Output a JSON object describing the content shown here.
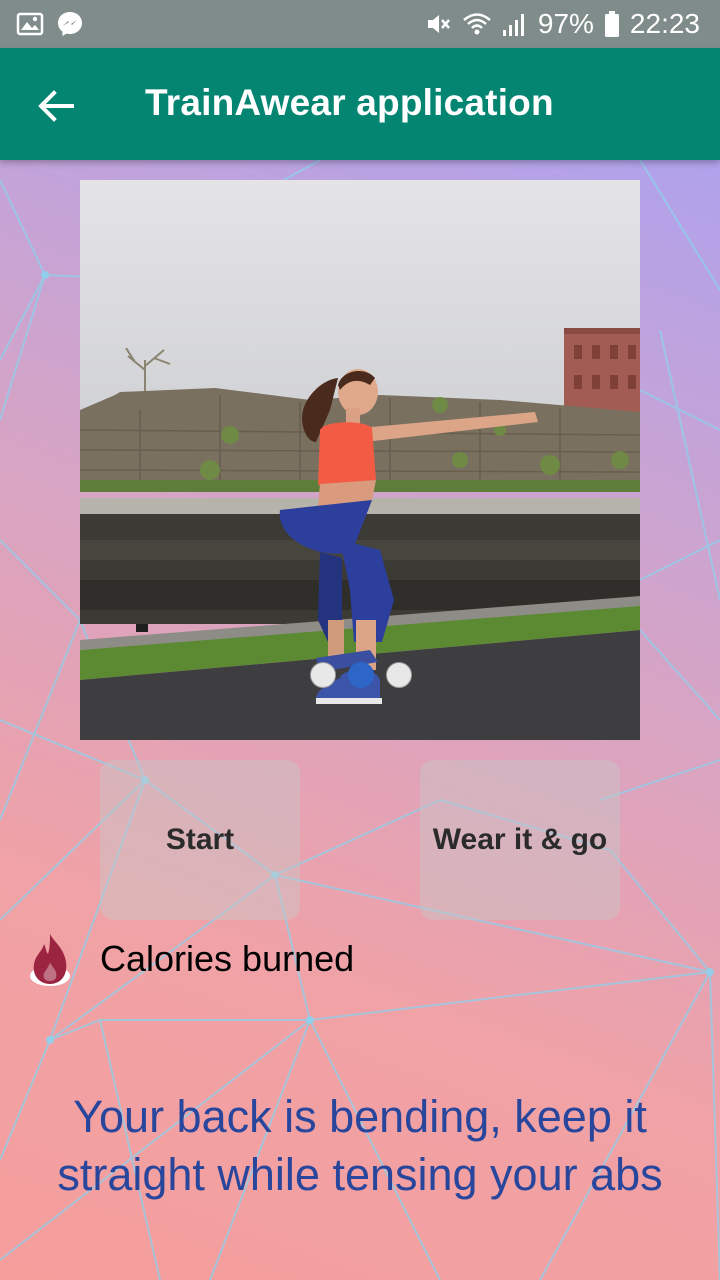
{
  "status_bar": {
    "battery": "97%",
    "time": "22:23",
    "left_icons": [
      "gallery-icon",
      "messenger-icon"
    ],
    "right_icons": [
      "mute-icon",
      "wifi-icon",
      "signal-icon",
      "battery-icon"
    ]
  },
  "app_bar": {
    "title": "TrainAwear application",
    "back_icon": "arrow-left-icon",
    "color": "#038572"
  },
  "exercise_image": {
    "description_icon": "exercise-photo",
    "carousel": {
      "count": 3,
      "active_index": 1
    }
  },
  "buttons": {
    "start": "Start",
    "wear_it": "Wear it & go"
  },
  "calories": {
    "label": "Calories burned",
    "icon": "flame-icon",
    "icon_color": "#9b2541"
  },
  "feedback": {
    "text": "Your back is bending, keep it straight while tensing your abs",
    "color": "#27469c"
  }
}
